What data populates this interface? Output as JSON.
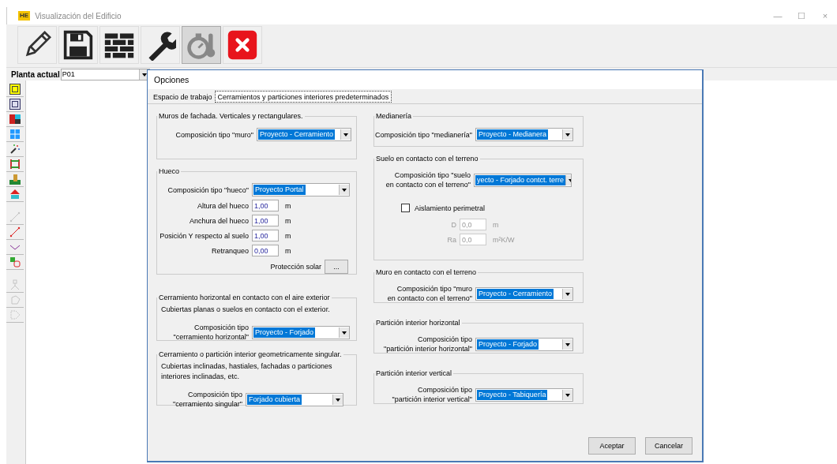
{
  "window": {
    "title": "Visualización del Edificio",
    "app_icon_label": "HE",
    "controls": [
      "—",
      "☐",
      "×"
    ]
  },
  "toolbar": [
    {
      "kind": "pencil",
      "pressed": false
    },
    {
      "kind": "save",
      "pressed": false
    },
    {
      "kind": "bricks",
      "pressed": false
    },
    {
      "kind": "wrench",
      "pressed": false
    },
    {
      "kind": "stopwatch",
      "pressed": true
    },
    {
      "kind": "close",
      "pressed": false
    }
  ],
  "floor_selector": {
    "label": "Planta actual",
    "value": "P01"
  },
  "tool_groups": [
    [
      {
        "kind": "frame-yellow",
        "disabled": false
      },
      {
        "kind": "frame-blue",
        "disabled": false
      },
      {
        "kind": "blocks",
        "disabled": false
      },
      {
        "kind": "window",
        "disabled": false
      },
      {
        "kind": "sparkle",
        "disabled": false
      },
      {
        "kind": "posts",
        "disabled": false
      },
      {
        "kind": "terrain",
        "disabled": false
      },
      {
        "kind": "roof",
        "disabled": false
      }
    ],
    [
      {
        "kind": "line",
        "disabled": true
      },
      {
        "kind": "line",
        "disabled": false
      },
      {
        "kind": "polyline",
        "disabled": false
      },
      {
        "kind": "copy",
        "disabled": false
      }
    ],
    [
      {
        "kind": "node",
        "disabled": true
      },
      {
        "kind": "polygon",
        "disabled": true
      },
      {
        "kind": "shape",
        "disabled": true
      }
    ]
  ],
  "dialog": {
    "title": "Opciones",
    "tabs": [
      {
        "label": "Espacio de trabajo",
        "selected": false
      },
      {
        "label": "Cerramientos y particiones interiores predeterminados",
        "selected": true
      }
    ],
    "left_groups": [
      {
        "title": "Muros de fachada. Verticales y rectangulares.",
        "rows": [
          {
            "kind": "combo",
            "label": [
              "Composición tipo \"muro\""
            ],
            "value": "Proyecto - Cerramiento"
          }
        ]
      },
      {
        "title": "Hueco",
        "rows": [
          {
            "kind": "combo",
            "label": [
              "Composición tipo \"hueco\""
            ],
            "value": "Proyecto Portal"
          },
          {
            "kind": "number",
            "label": [
              "Altura del hueco"
            ],
            "value": "1,00",
            "unit": "m",
            "disabled": false
          },
          {
            "kind": "number",
            "label": [
              "Anchura del hueco"
            ],
            "value": "1,00",
            "unit": "m",
            "disabled": false
          },
          {
            "kind": "number",
            "label": [
              "Posición Y respecto al suelo"
            ],
            "value": "1,00",
            "unit": "m",
            "disabled": false
          },
          {
            "kind": "number",
            "label": [
              "Retranqueo"
            ],
            "value": "0,00",
            "unit": "m",
            "disabled": false
          },
          {
            "kind": "button",
            "label": [
              "Protección solar"
            ],
            "value": "..."
          }
        ]
      },
      {
        "title": "Cerramiento horizontal en contacto con el aire exterior",
        "note": "Cubiertas planas o suelos en contacto con el exterior.",
        "rows": [
          {
            "kind": "combo",
            "label": [
              "Composición tipo",
              "\"cerramiento horizontal\""
            ],
            "value": "Proyecto - Forjado"
          }
        ]
      },
      {
        "title": "Cerramiento o partición interior geometricamente singular.",
        "note": "Cubiertas inclinadas, hastiales, fachadas o particiones interiores inclinadas, etc.",
        "rows": [
          {
            "kind": "combo",
            "label": [
              "Composición tipo",
              "\"cerramiento singular\""
            ],
            "value": "Forjado cubierta"
          }
        ]
      }
    ],
    "right_groups": [
      {
        "title": "Medianería",
        "rows": [
          {
            "kind": "combo",
            "label": [
              "Composición tipo \"medianería\""
            ],
            "value": "Proyecto - Medianera"
          }
        ]
      },
      {
        "title": "Suelo en contacto con el terreno",
        "rows": [
          {
            "kind": "combo",
            "label": [
              "Composición tipo \"suelo",
              "en contacto con el terreno\""
            ],
            "value": "yecto - Forjado contct. terre"
          },
          {
            "kind": "checkbox",
            "label": [
              "Aislamiento perimetral"
            ],
            "checked": false
          },
          {
            "kind": "number",
            "label": [
              "D"
            ],
            "value": "0,0",
            "unit": "m",
            "disabled": true
          },
          {
            "kind": "number",
            "label": [
              "Ra"
            ],
            "value": "0,0",
            "unit": "m²K/W",
            "disabled": true
          }
        ]
      },
      {
        "title": "Muro en contacto con el terreno",
        "rows": [
          {
            "kind": "combo",
            "label": [
              "Composición tipo \"muro",
              "en contacto con el terreno\""
            ],
            "value": "Proyecto - Cerramiento"
          }
        ]
      },
      {
        "title": "Partición interior horizontal",
        "rows": [
          {
            "kind": "combo",
            "label": [
              "Composición tipo",
              "\"partición interior horizontal\""
            ],
            "value": "Proyecto - Forjado"
          }
        ]
      },
      {
        "title": "Partición interior vertical",
        "rows": [
          {
            "kind": "combo",
            "label": [
              "Composición tipo",
              "\"partición interior vertical\""
            ],
            "value": "Proyecto - Tabiquería"
          }
        ]
      }
    ],
    "buttons": [
      "Aceptar",
      "Cancelar"
    ]
  }
}
